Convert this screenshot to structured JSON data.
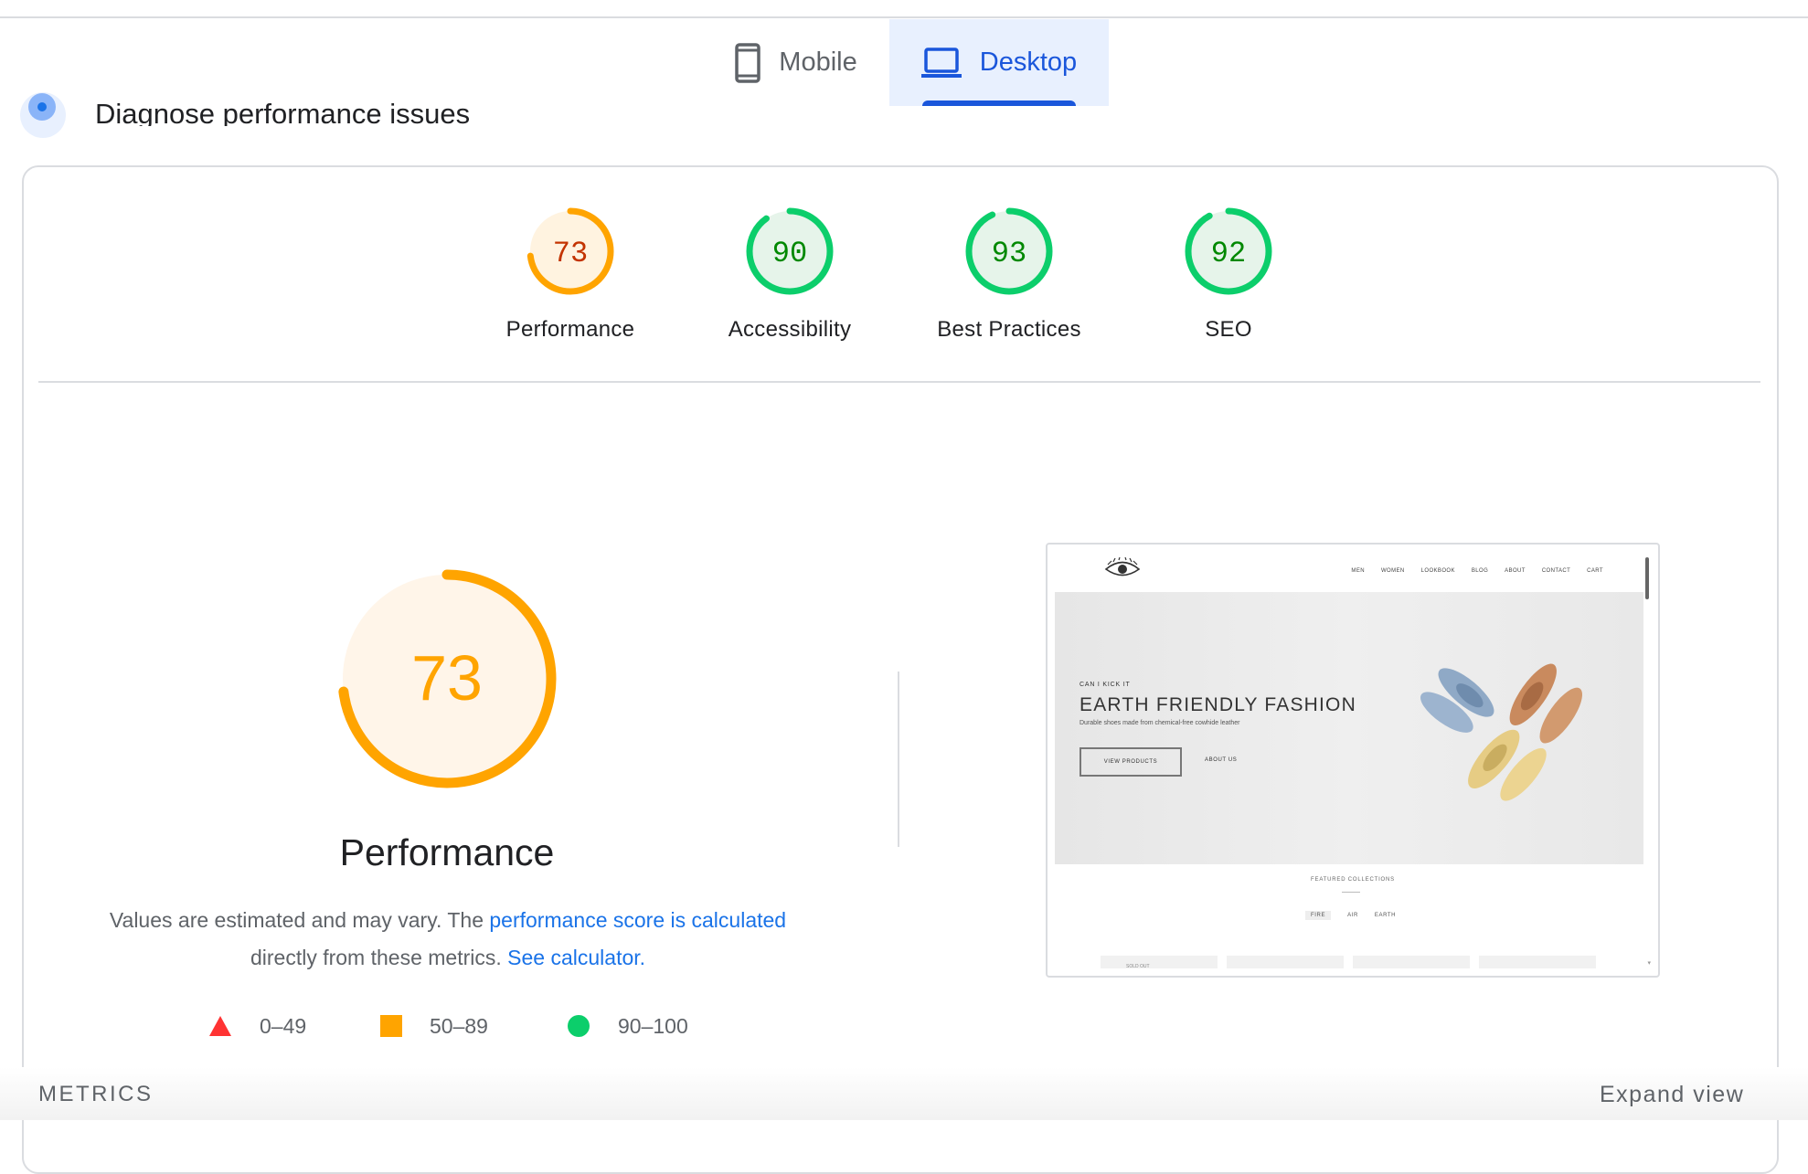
{
  "tabs": [
    {
      "label": "Mobile",
      "icon": "phone-icon",
      "active": false
    },
    {
      "label": "Desktop",
      "icon": "laptop-icon",
      "active": true
    }
  ],
  "section": {
    "title": "Diagnose performance issues",
    "icon": "diagnose-icon"
  },
  "scores": [
    {
      "label": "Performance",
      "value": "73",
      "color": "#ffa400",
      "text_color": "#c33300",
      "fill": "#fff3e0"
    },
    {
      "label": "Accessibility",
      "value": "90",
      "color": "#0cce6b",
      "text_color": "#008800",
      "fill": "#e6f4ea"
    },
    {
      "label": "Best Practices",
      "value": "93",
      "color": "#0cce6b",
      "text_color": "#008800",
      "fill": "#e6f4ea"
    },
    {
      "label": "SEO",
      "value": "92",
      "color": "#0cce6b",
      "text_color": "#008800",
      "fill": "#e6f4ea"
    }
  ],
  "main": {
    "score": "73",
    "title": "Performance",
    "desc_prefix": "Values are estimated and may vary. The ",
    "desc_link1": "performance score is calculated",
    "desc_middle": " directly from these metrics. ",
    "desc_link2": "See calculator."
  },
  "legend": [
    {
      "range": "0–49",
      "shape": "triangle",
      "color": "#ff3333"
    },
    {
      "range": "50–89",
      "shape": "square",
      "color": "#ffa400"
    },
    {
      "range": "90–100",
      "shape": "circle",
      "color": "#0cce6b"
    }
  ],
  "screenshot": {
    "nav": [
      "MEN",
      "WOMEN",
      "LOOKBOOK",
      "BLOG",
      "ABOUT",
      "CONTACT",
      "CART"
    ],
    "kicker": "CAN I KICK IT",
    "headline": "EARTH FRIENDLY FASHION",
    "subtitle": "Durable shoes made from chemical-free cowhide leather",
    "primary_button": "VIEW PRODUCTS",
    "secondary_link": "ABOUT US",
    "featured": "FEATURED COLLECTIONS",
    "filters": [
      "FIRE",
      "AIR",
      "EARTH"
    ],
    "sold_out": "SOLD OUT"
  },
  "footer": {
    "metrics_label": "METRICS",
    "expand_label": "Expand view"
  }
}
